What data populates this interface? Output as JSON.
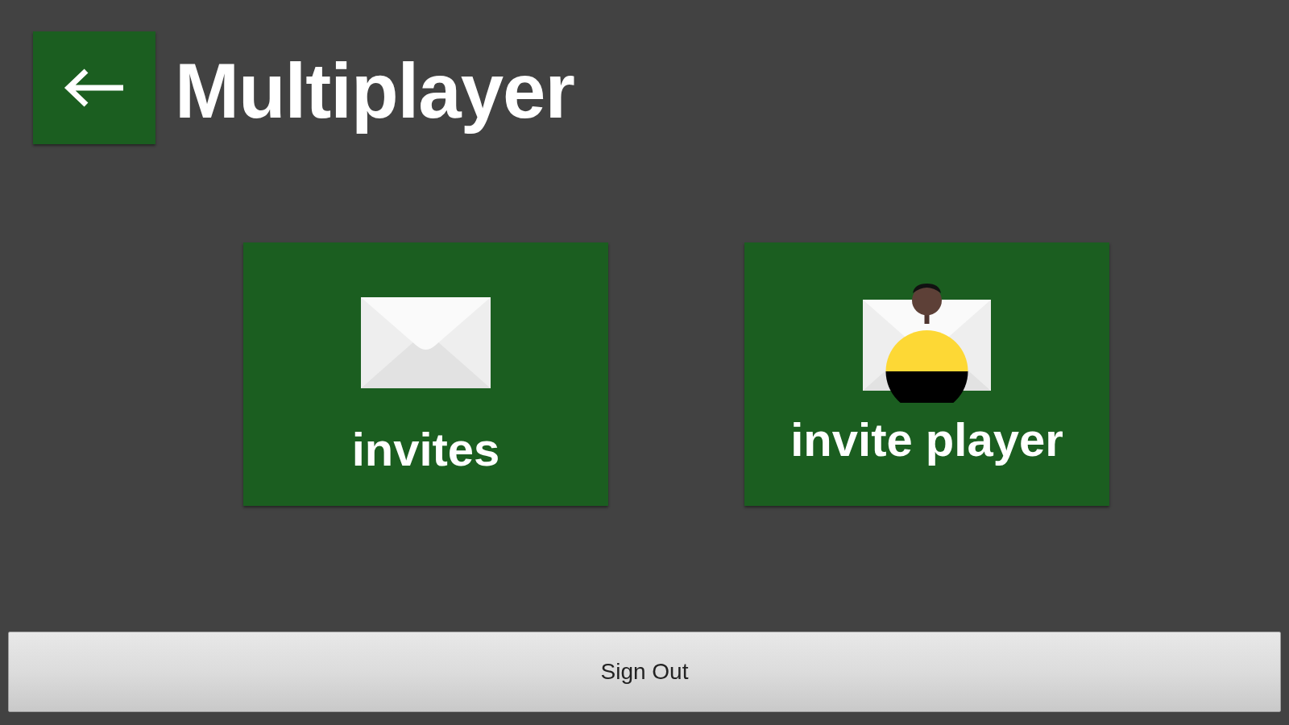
{
  "header": {
    "title": "Multiplayer"
  },
  "tiles": [
    {
      "kind": "invites",
      "label": "invites"
    },
    {
      "kind": "invite_player",
      "label": "invite player"
    }
  ],
  "sign_out_button": {
    "label": "Sign Out"
  }
}
